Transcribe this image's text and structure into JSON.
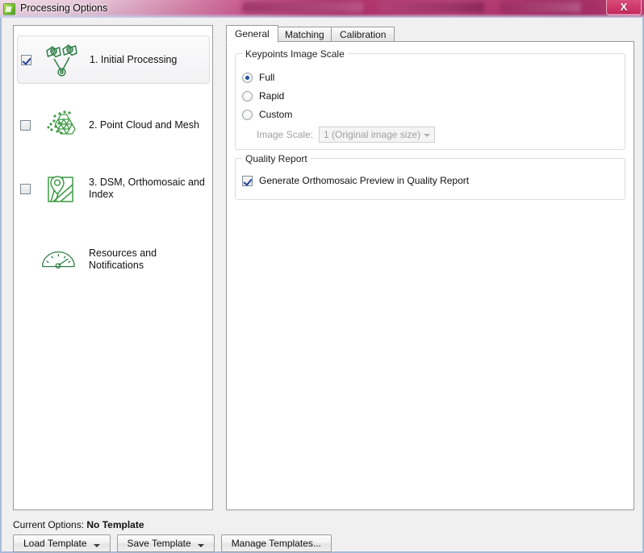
{
  "window": {
    "title": "Processing Options",
    "app_icon": "pix4d-app-icon",
    "close_label": "X"
  },
  "accent_colors": {
    "icon_green": "#2f7d46",
    "check_blue": "#21409a",
    "radio_blue": "#1b4f9c",
    "titlebar_magenta": "#a01955"
  },
  "steps": {
    "items": [
      {
        "label": "1. Initial Processing",
        "checked": true,
        "selected": true,
        "icon": "camera-triangulation-icon"
      },
      {
        "label": "2. Point Cloud and Mesh",
        "checked": false,
        "selected": false,
        "icon": "point-cloud-mesh-icon"
      },
      {
        "label": "3. DSM, Orthomosaic and Index",
        "checked": false,
        "selected": false,
        "icon": "map-pin-icon"
      },
      {
        "label": "Resources and Notifications",
        "checked": null,
        "selected": false,
        "icon": "gauge-icon"
      }
    ]
  },
  "tabs": [
    {
      "label": "General",
      "active": true
    },
    {
      "label": "Matching",
      "active": false
    },
    {
      "label": "Calibration",
      "active": false
    }
  ],
  "general_tab": {
    "keypoints_group": {
      "title": "Keypoints Image Scale",
      "options": [
        {
          "label": "Full",
          "selected": true
        },
        {
          "label": "Rapid",
          "selected": false
        },
        {
          "label": "Custom",
          "selected": false
        }
      ],
      "image_scale": {
        "label": "Image Scale:",
        "value": "1 (Original image size)",
        "enabled": false
      }
    },
    "quality_group": {
      "title": "Quality Report",
      "checkbox": {
        "label": "Generate Orthomosaic Preview in Quality Report",
        "checked": true
      }
    }
  },
  "footer": {
    "status_label": "Current Options:",
    "status_value": "No Template",
    "buttons": [
      {
        "label": "Load Template",
        "has_dropdown": true
      },
      {
        "label": "Save Template",
        "has_dropdown": true
      },
      {
        "label": "Manage Templates...",
        "has_dropdown": false
      }
    ]
  }
}
